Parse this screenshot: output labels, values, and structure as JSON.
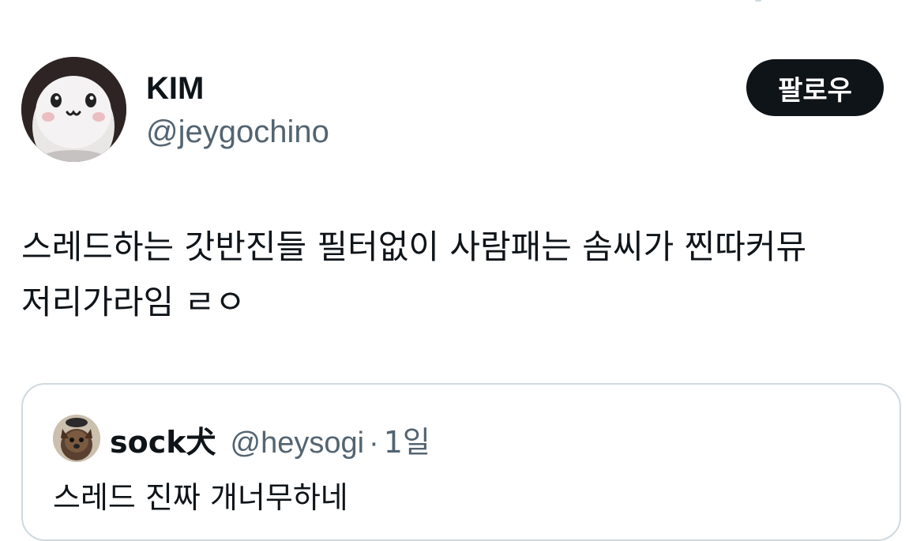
{
  "author": {
    "display_name": "KIM",
    "handle": "@jeygochino",
    "avatar_icon": "white-cartoon-character-avatar"
  },
  "follow_button": {
    "label": "팔로우"
  },
  "tweet": {
    "text": "스레드하는 갓반진들 필터없이 사람패는 솜씨가 찐따커뮤\n저리가라임 ㄹㅇ"
  },
  "quoted_tweet": {
    "display_name": "sock犬",
    "handle": "@heysogi",
    "separator": "·",
    "time": "1일",
    "text": "스레드 진짜 개너무하네",
    "avatar_icon": "small-dog-avatar"
  },
  "colors": {
    "text_primary": "#0f1419",
    "text_secondary": "#536471",
    "border": "#cfd9de",
    "button_bg": "#0f1419",
    "button_text": "#ffffff"
  }
}
